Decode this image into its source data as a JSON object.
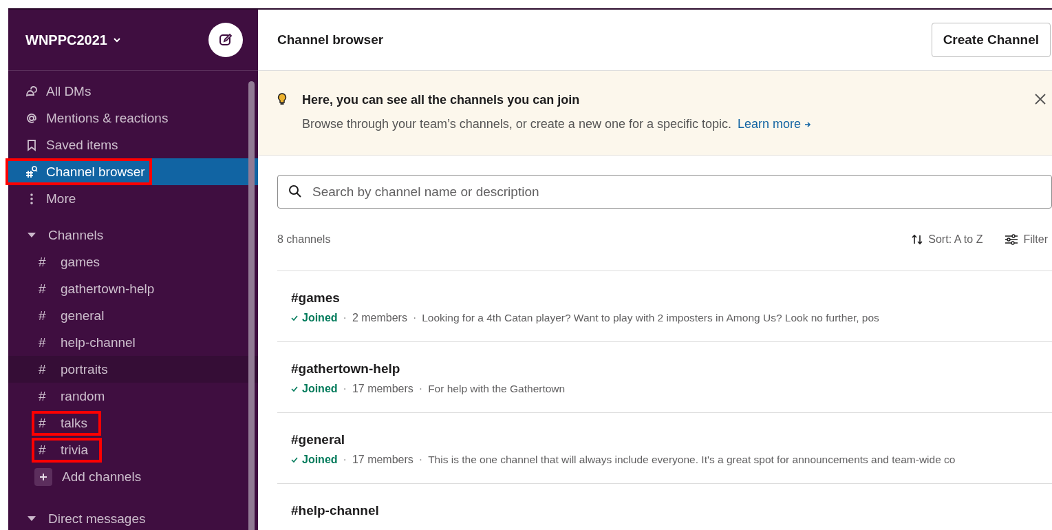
{
  "workspace": {
    "name": "WNPPC2021"
  },
  "nav": [
    {
      "kind": "dms",
      "label": "All DMs",
      "selected": false,
      "annotated": false
    },
    {
      "kind": "mentions",
      "label": "Mentions & reactions",
      "selected": false,
      "annotated": false
    },
    {
      "kind": "saved",
      "label": "Saved items",
      "selected": false,
      "annotated": false
    },
    {
      "kind": "browser",
      "label": "Channel browser",
      "selected": true,
      "annotated": true
    },
    {
      "kind": "more",
      "label": "More",
      "selected": false,
      "annotated": false
    }
  ],
  "channels_section": {
    "label": "Channels",
    "expanded": true,
    "items": [
      {
        "symbol": "#",
        "name": "games",
        "hovered": false,
        "annotated": false
      },
      {
        "symbol": "#",
        "name": "gathertown-help",
        "hovered": false,
        "annotated": false
      },
      {
        "symbol": "#",
        "name": "general",
        "hovered": false,
        "annotated": false
      },
      {
        "symbol": "#",
        "name": "help-channel",
        "hovered": false,
        "annotated": false
      },
      {
        "symbol": "#",
        "name": "portraits",
        "hovered": true,
        "annotated": false
      },
      {
        "symbol": "#",
        "name": "random",
        "hovered": false,
        "annotated": false
      },
      {
        "symbol": "#",
        "name": "talks",
        "hovered": false,
        "annotated": true
      },
      {
        "symbol": "#",
        "name": "trivia",
        "hovered": false,
        "annotated": true
      }
    ],
    "add_label": "Add channels"
  },
  "dm_section": {
    "label": "Direct messages",
    "expanded": true
  },
  "header": {
    "title": "Channel browser",
    "create_button": "Create Channel"
  },
  "banner": {
    "title": "Here, you can see all the channels you can join",
    "text": "Browse through your team’s channels, or create a new one for a specific topic.",
    "link": "Learn more"
  },
  "search": {
    "placeholder": "Search by channel name or description"
  },
  "count": "8 channels",
  "separator": "·",
  "sort": "Sort: A to Z",
  "filter": "Filter",
  "results": [
    {
      "name": "#games",
      "joined": true,
      "status": "Joined",
      "members": "2 members",
      "description": "Looking for a 4th Catan player? Want to play with 2 imposters in Among Us? Look no further, pos"
    },
    {
      "name": "#gathertown-help",
      "joined": true,
      "status": "Joined",
      "members": "17 members",
      "description": "For help with the Gathertown"
    },
    {
      "name": "#general",
      "joined": true,
      "status": "Joined",
      "members": "17 members",
      "description": "This is the one channel that will always include everyone. It's a great spot for announcements and team-wide co"
    },
    {
      "name": "#help-channel"
    }
  ]
}
